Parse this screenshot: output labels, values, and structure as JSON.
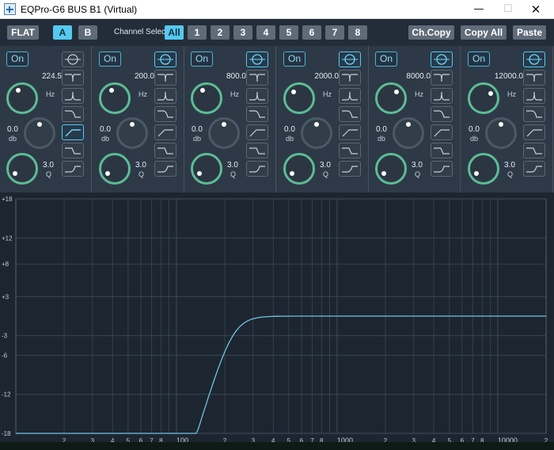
{
  "window": {
    "title": "EQPro-G6 BUS B1 (Virtual)",
    "minimize": "—",
    "maximize": "☐",
    "close": "✕"
  },
  "toolbar": {
    "flat": "FLAT",
    "a": "A",
    "b": "B",
    "channel_select_label": "Channel Select:",
    "channels": [
      "All",
      "1",
      "2",
      "3",
      "4",
      "5",
      "6",
      "7",
      "8"
    ],
    "active_channel": "All",
    "active_ab": "A",
    "ch_copy": "Ch.Copy",
    "copy_all": "Copy All",
    "paste": "Paste"
  },
  "bands": [
    {
      "on": "On",
      "freq": "224.5",
      "hz": "Hz",
      "gain": "0.0",
      "db": "db",
      "q": "3.0",
      "q_unit": "Q",
      "selected_type": 4
    },
    {
      "on": "On",
      "freq": "200.0",
      "hz": "Hz",
      "gain": "0.0",
      "db": "db",
      "q": "3.0",
      "q_unit": "Q",
      "selected_type": 0
    },
    {
      "on": "On",
      "freq": "800.0",
      "hz": "Hz",
      "gain": "0.0",
      "db": "db",
      "q": "3.0",
      "q_unit": "Q",
      "selected_type": 0
    },
    {
      "on": "On",
      "freq": "2000.0",
      "hz": "Hz",
      "gain": "0.0",
      "db": "db",
      "q": "3.0",
      "q_unit": "Q",
      "selected_type": 0
    },
    {
      "on": "On",
      "freq": "8000.0",
      "hz": "Hz",
      "gain": "0.0",
      "db": "db",
      "q": "3.0",
      "q_unit": "Q",
      "selected_type": 0
    },
    {
      "on": "On",
      "freq": "12000.0",
      "hz": "Hz",
      "gain": "0.0",
      "db": "db",
      "q": "3.0",
      "q_unit": "Q",
      "selected_type": 0
    }
  ],
  "filter_types": [
    "peak",
    "notch",
    "band",
    "high-shelf",
    "low-cut",
    "high-cut",
    "low-shelf"
  ],
  "graph": {
    "y_labels": [
      "+18",
      "+12",
      "+8",
      "+3",
      "-3",
      "-6",
      "-12",
      "-18"
    ],
    "y_values": [
      18,
      12,
      8,
      3,
      -3,
      -6,
      -12,
      -18
    ],
    "x_labels": [
      {
        "f": 20,
        "t": "2"
      },
      {
        "f": 30,
        "t": "3"
      },
      {
        "f": 40,
        "t": "4"
      },
      {
        "f": 50,
        "t": "5"
      },
      {
        "f": 60,
        "t": "6"
      },
      {
        "f": 70,
        "t": "7"
      },
      {
        "f": 80,
        "t": "8"
      },
      {
        "f": 100,
        "t": "100"
      },
      {
        "f": 200,
        "t": "2"
      },
      {
        "f": 300,
        "t": "3"
      },
      {
        "f": 400,
        "t": "4"
      },
      {
        "f": 500,
        "t": "5"
      },
      {
        "f": 600,
        "t": "6"
      },
      {
        "f": 700,
        "t": "7"
      },
      {
        "f": 800,
        "t": "8"
      },
      {
        "f": 1000,
        "t": "1000"
      },
      {
        "f": 2000,
        "t": "2"
      },
      {
        "f": 3000,
        "t": "3"
      },
      {
        "f": 4000,
        "t": "4"
      },
      {
        "f": 5000,
        "t": "5"
      },
      {
        "f": 6000,
        "t": "6"
      },
      {
        "f": 7000,
        "t": "7"
      },
      {
        "f": 8000,
        "t": "8"
      },
      {
        "f": 10000,
        "t": "10000"
      },
      {
        "f": 20000,
        "t": "2"
      }
    ],
    "curve_color": "#6ec3e2",
    "grid_color": "#3c4a58"
  }
}
